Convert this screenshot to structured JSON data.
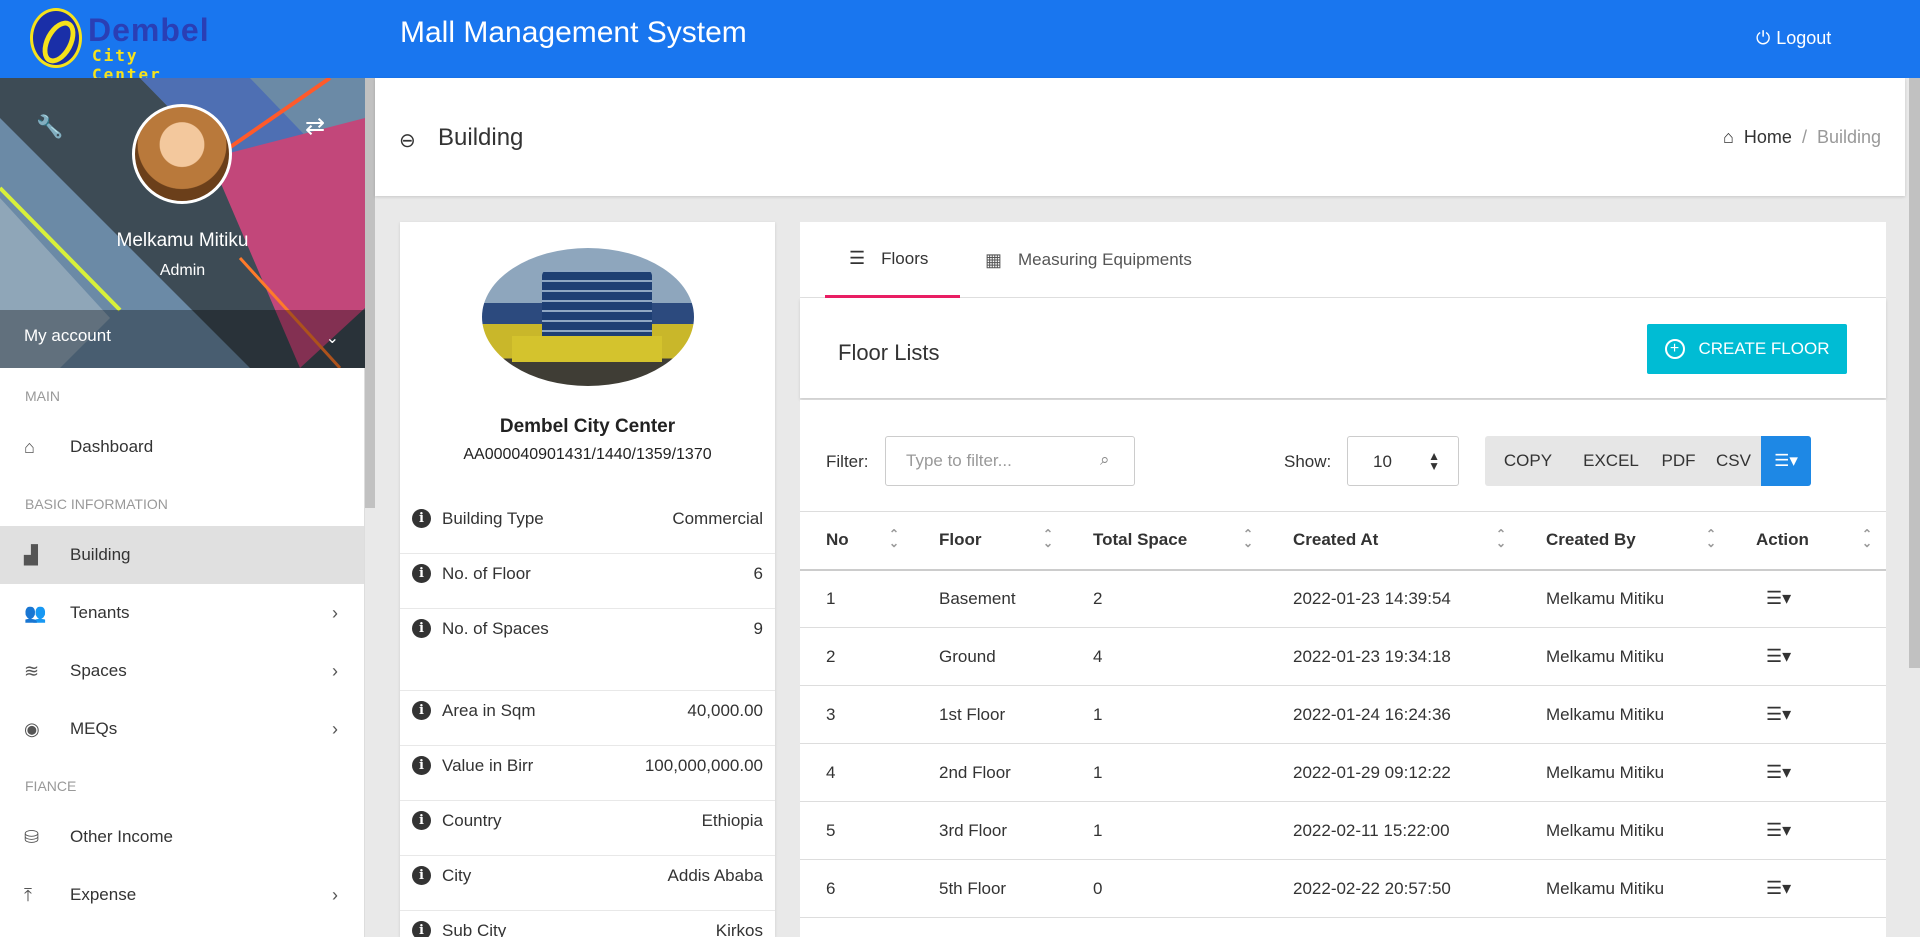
{
  "app": {
    "logo_top": "Dembel",
    "logo_bottom": "City Center",
    "title": "Mall Management System",
    "logout_label": "Logout"
  },
  "profile": {
    "name": "Melkamu Mitiku",
    "role": "Admin",
    "account_label": "My account"
  },
  "menu": {
    "sections": [
      "MAIN",
      "BASIC INFORMATION",
      "FIANCE"
    ],
    "items": [
      {
        "label": "Dashboard",
        "icon": "home-icon"
      },
      {
        "label": "Building",
        "icon": "building-icon",
        "active": true
      },
      {
        "label": "Tenants",
        "icon": "users-icon"
      },
      {
        "label": "Spaces",
        "icon": "layers-icon"
      },
      {
        "label": "MEQs",
        "icon": "eye-icon"
      },
      {
        "label": "Other Income",
        "icon": "coins-icon"
      },
      {
        "label": "Expense",
        "icon": "upload-icon"
      }
    ]
  },
  "page": {
    "title": "Building",
    "breadcrumb": {
      "home": "Home",
      "current": "Building"
    }
  },
  "building": {
    "name": "Dembel City Center",
    "code": "AA000040901431/1440/1359/1370",
    "attributes": [
      {
        "label": "Building Type",
        "value": "Commercial"
      },
      {
        "label": "No. of Floor",
        "value": "6"
      },
      {
        "label": "No. of Spaces",
        "value": "9"
      },
      {
        "label": "Area in Sqm",
        "value": "40,000.00"
      },
      {
        "label": "Value in Birr",
        "value": "100,000,000.00"
      },
      {
        "label": "Country",
        "value": "Ethiopia"
      },
      {
        "label": "City",
        "value": "Addis Ababa"
      },
      {
        "label": "Sub City",
        "value": "Kirkos"
      }
    ]
  },
  "tabs": [
    {
      "label": "Floors",
      "active": true
    },
    {
      "label": "Measuring Equipments"
    }
  ],
  "floors": {
    "title": "Floor Lists",
    "create_label": "CREATE FLOOR",
    "filter_label": "Filter:",
    "filter_placeholder": "Type to filter...",
    "show_label": "Show:",
    "show_value": "10",
    "export_buttons": [
      "COPY",
      "EXCEL",
      "PDF",
      "CSV"
    ],
    "columns": [
      "No",
      "Floor",
      "Total Space",
      "Created At",
      "Created By",
      "Action"
    ],
    "rows": [
      [
        "1",
        "Basement",
        "2",
        "2022-01-23 14:39:54",
        "Melkamu Mitiku"
      ],
      [
        "2",
        "Ground",
        "4",
        "2022-01-23 19:34:18",
        "Melkamu Mitiku"
      ],
      [
        "3",
        "1st Floor",
        "1",
        "2022-01-24 16:24:36",
        "Melkamu Mitiku"
      ],
      [
        "4",
        "2nd Floor",
        "1",
        "2022-01-29 09:12:22",
        "Melkamu Mitiku"
      ],
      [
        "5",
        "3rd Floor",
        "1",
        "2022-02-11 15:22:00",
        "Melkamu Mitiku"
      ],
      [
        "6",
        "5th Floor",
        "0",
        "2022-02-22 20:57:50",
        "Melkamu Mitiku"
      ]
    ]
  }
}
